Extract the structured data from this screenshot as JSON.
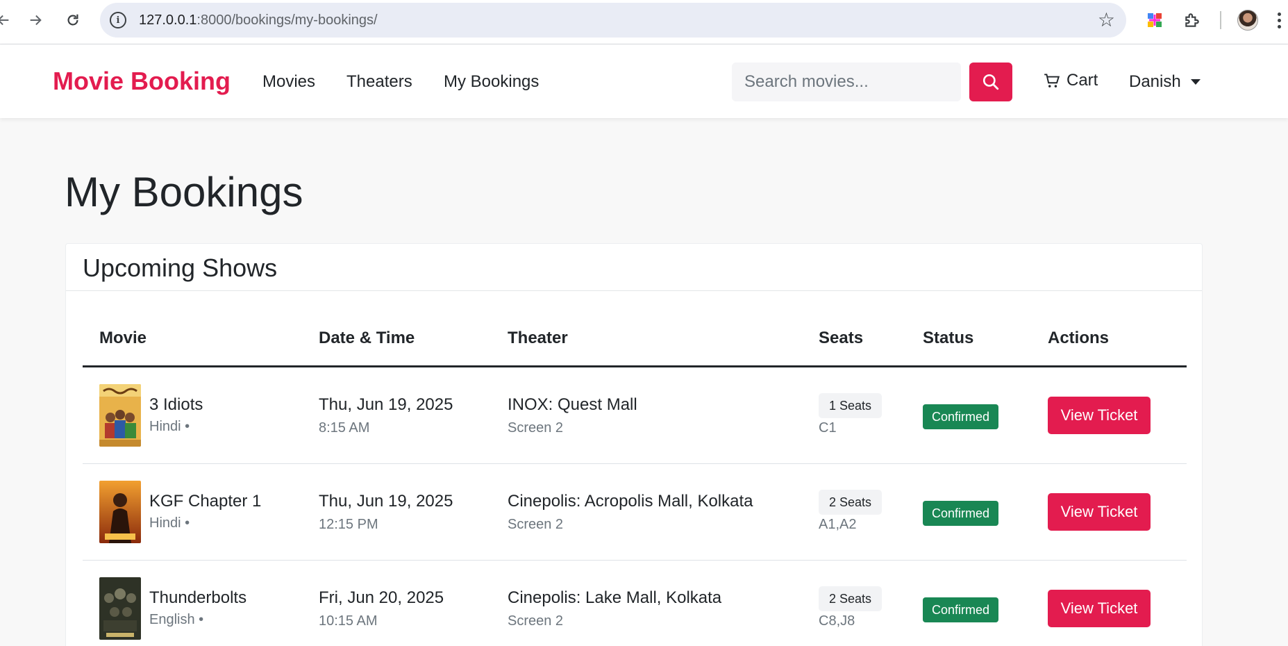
{
  "browser": {
    "url_host": "127.0.0.1",
    "url_path": ":8000/bookings/my-bookings/"
  },
  "navbar": {
    "brand": "Movie Booking",
    "links": [
      "Movies",
      "Theaters",
      "My Bookings"
    ],
    "search_placeholder": "Search movies...",
    "cart_label": "Cart",
    "user_name": "Danish"
  },
  "page": {
    "title": "My Bookings",
    "section_title": "Upcoming Shows"
  },
  "table": {
    "headers": [
      "Movie",
      "Date & Time",
      "Theater",
      "Seats",
      "Status",
      "Actions"
    ],
    "rows": [
      {
        "movie": "3 Idiots",
        "language": "Hindi •",
        "date": "Thu, Jun 19, 2025",
        "time": "8:15 AM",
        "theater": "INOX: Quest Mall",
        "screen": "Screen 2",
        "seat_count": "1 Seats",
        "seats": "C1",
        "status": "Confirmed",
        "action": "View Ticket"
      },
      {
        "movie": "KGF Chapter 1",
        "language": "Hindi •",
        "date": "Thu, Jun 19, 2025",
        "time": "12:15 PM",
        "theater": "Cinepolis: Acropolis Mall, Kolkata",
        "screen": "Screen 2",
        "seat_count": "2 Seats",
        "seats": "A1,A2",
        "status": "Confirmed",
        "action": "View Ticket"
      },
      {
        "movie": "Thunderbolts",
        "language": "English •",
        "date": "Fri, Jun 20, 2025",
        "time": "10:15 AM",
        "theater": "Cinepolis: Lake Mall, Kolkata",
        "screen": "Screen 2",
        "seat_count": "2 Seats",
        "seats": "C8,J8",
        "status": "Confirmed",
        "action": "View Ticket"
      }
    ]
  },
  "colors": {
    "brand": "#e31c4f",
    "status_confirmed": "#198754"
  }
}
